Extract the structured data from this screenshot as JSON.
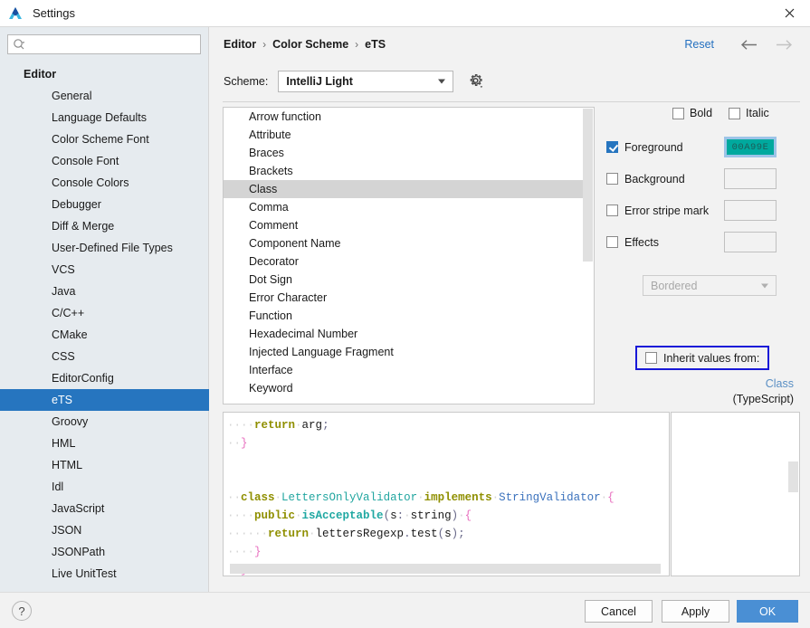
{
  "window": {
    "title": "Settings",
    "logo_icon": "app-logo-icon",
    "close_icon": "close-icon"
  },
  "sidebar": {
    "search": {
      "placeholder": "",
      "value": "",
      "icon": "search-icon"
    },
    "group_label": "Editor",
    "items": [
      {
        "label": "General",
        "selected": false
      },
      {
        "label": "Language Defaults",
        "selected": false
      },
      {
        "label": "Color Scheme Font",
        "selected": false
      },
      {
        "label": "Console Font",
        "selected": false
      },
      {
        "label": "Console Colors",
        "selected": false
      },
      {
        "label": "Debugger",
        "selected": false
      },
      {
        "label": "Diff & Merge",
        "selected": false
      },
      {
        "label": "User-Defined File Types",
        "selected": false
      },
      {
        "label": "VCS",
        "selected": false
      },
      {
        "label": "Java",
        "selected": false
      },
      {
        "label": "C/C++",
        "selected": false
      },
      {
        "label": "CMake",
        "selected": false
      },
      {
        "label": "CSS",
        "selected": false
      },
      {
        "label": "EditorConfig",
        "selected": false
      },
      {
        "label": "eTS",
        "selected": true
      },
      {
        "label": "Groovy",
        "selected": false
      },
      {
        "label": "HML",
        "selected": false
      },
      {
        "label": "HTML",
        "selected": false
      },
      {
        "label": "Idl",
        "selected": false
      },
      {
        "label": "JavaScript",
        "selected": false
      },
      {
        "label": "JSON",
        "selected": false
      },
      {
        "label": "JSONPath",
        "selected": false
      },
      {
        "label": "Live UnitTest",
        "selected": false
      }
    ]
  },
  "header": {
    "breadcrumb": [
      "Editor",
      "Color Scheme",
      "eTS"
    ],
    "separator": "›",
    "reset_label": "Reset",
    "back_icon": "arrow-left-icon",
    "forward_icon": "arrow-right-icon"
  },
  "scheme": {
    "label": "Scheme:",
    "value": "IntelliJ Light",
    "gear_icon": "gear-icon"
  },
  "attributes": {
    "items": [
      {
        "label": "Arrow function",
        "selected": false
      },
      {
        "label": "Attribute",
        "selected": false
      },
      {
        "label": "Braces",
        "selected": false
      },
      {
        "label": "Brackets",
        "selected": false
      },
      {
        "label": "Class",
        "selected": true
      },
      {
        "label": "Comma",
        "selected": false
      },
      {
        "label": "Comment",
        "selected": false
      },
      {
        "label": "Component Name",
        "selected": false
      },
      {
        "label": "Decorator",
        "selected": false
      },
      {
        "label": "Dot Sign",
        "selected": false
      },
      {
        "label": "Error Character",
        "selected": false
      },
      {
        "label": "Function",
        "selected": false
      },
      {
        "label": "Hexadecimal Number",
        "selected": false
      },
      {
        "label": "Injected Language Fragment",
        "selected": false
      },
      {
        "label": "Interface",
        "selected": false
      },
      {
        "label": "Keyword",
        "selected": false
      }
    ]
  },
  "controls": {
    "bold": {
      "label": "Bold",
      "checked": false
    },
    "italic": {
      "label": "Italic",
      "checked": false
    },
    "foreground": {
      "label": "Foreground",
      "checked": true,
      "color": "00A99E"
    },
    "background": {
      "label": "Background",
      "checked": false,
      "color": ""
    },
    "error_stripe": {
      "label": "Error stripe mark",
      "checked": false,
      "color": ""
    },
    "effects": {
      "label": "Effects",
      "checked": false,
      "color": ""
    },
    "effect_type": {
      "value": "Bordered"
    },
    "inherit": {
      "label": "Inherit values from:",
      "checked": false
    },
    "inherit_target_name": "Class",
    "inherit_target_lang": "(TypeScript)"
  },
  "preview": {
    "lines": [
      [
        {
          "t": "····",
          "c": "ws"
        },
        {
          "t": "return",
          "c": "kw"
        },
        {
          "t": "·",
          "c": "ws"
        },
        {
          "t": "arg",
          "c": "plain"
        },
        {
          "t": ";",
          "c": "punc"
        }
      ],
      [
        {
          "t": "··",
          "c": "ws"
        },
        {
          "t": "}",
          "c": "brace"
        }
      ],
      [],
      [],
      [
        {
          "t": "··",
          "c": "ws"
        },
        {
          "t": "class",
          "c": "kw"
        },
        {
          "t": "·",
          "c": "ws"
        },
        {
          "t": "LettersOnlyValidator",
          "c": "cls"
        },
        {
          "t": "·",
          "c": "ws"
        },
        {
          "t": "implements",
          "c": "kw"
        },
        {
          "t": "·",
          "c": "ws"
        },
        {
          "t": "StringValidator",
          "c": "iface"
        },
        {
          "t": "·",
          "c": "ws"
        },
        {
          "t": "{",
          "c": "brace"
        }
      ],
      [
        {
          "t": "····",
          "c": "ws"
        },
        {
          "t": "public",
          "c": "kw"
        },
        {
          "t": "·",
          "c": "ws"
        },
        {
          "t": "isAcceptable",
          "c": "fn"
        },
        {
          "t": "(",
          "c": "punc"
        },
        {
          "t": "s",
          "c": "plain"
        },
        {
          "t": ":",
          "c": "punc"
        },
        {
          "t": "·",
          "c": "ws"
        },
        {
          "t": "string",
          "c": "plain"
        },
        {
          "t": ")",
          "c": "punc"
        },
        {
          "t": "·",
          "c": "ws"
        },
        {
          "t": "{",
          "c": "brace"
        }
      ],
      [
        {
          "t": "······",
          "c": "ws"
        },
        {
          "t": "return",
          "c": "kw"
        },
        {
          "t": "·",
          "c": "ws"
        },
        {
          "t": "lettersRegexp",
          "c": "plain"
        },
        {
          "t": ".",
          "c": "punc"
        },
        {
          "t": "test",
          "c": "plain"
        },
        {
          "t": "(",
          "c": "punc"
        },
        {
          "t": "s",
          "c": "plain"
        },
        {
          "t": ")",
          "c": "punc"
        },
        {
          "t": ";",
          "c": "punc"
        }
      ],
      [
        {
          "t": "····",
          "c": "ws"
        },
        {
          "t": "}",
          "c": "brace"
        }
      ],
      [
        {
          "t": "··",
          "c": "ws"
        },
        {
          "t": "}",
          "c": "brace"
        }
      ]
    ]
  },
  "footer": {
    "help_label": "?",
    "cancel_label": "Cancel",
    "apply_label": "Apply",
    "ok_label": "OK"
  },
  "colors": {
    "accent": "#2675bf",
    "link": "#2470c0",
    "selection": "#2675bf",
    "ok_button": "#4a8fd4",
    "highlight_border": "#1818d8",
    "foreground_swatch": "#00a99e"
  }
}
